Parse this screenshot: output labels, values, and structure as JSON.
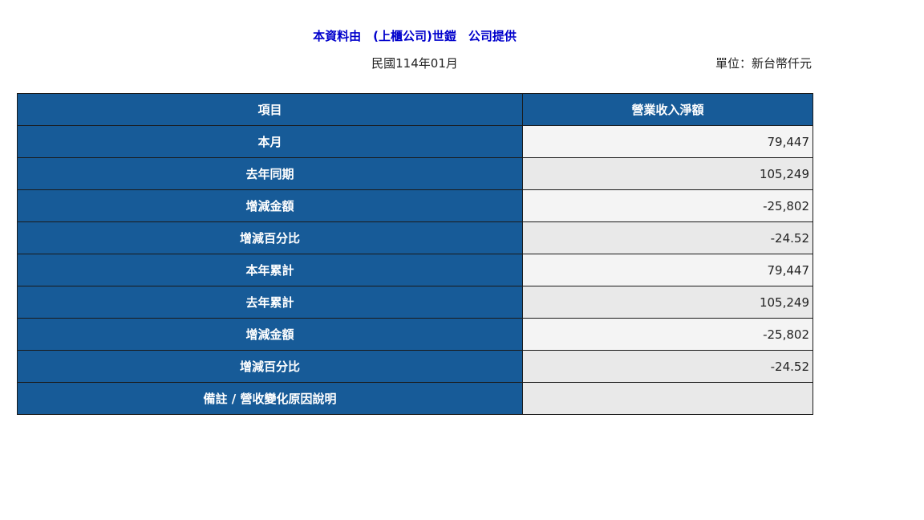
{
  "header": {
    "title": "本資料由　(上櫃公司)世鎧　公司提供",
    "period": "民國114年01月",
    "unit": "單位：新台幣仟元"
  },
  "table": {
    "col_item": "項目",
    "col_revenue": "營業收入淨額",
    "rows": [
      {
        "label": "本月",
        "value": "79,447"
      },
      {
        "label": "去年同期",
        "value": "105,249"
      },
      {
        "label": "增減金額",
        "value": "-25,802"
      },
      {
        "label": "增減百分比",
        "value": "-24.52"
      },
      {
        "label": "本年累計",
        "value": "79,447"
      },
      {
        "label": "去年累計",
        "value": "105,249"
      },
      {
        "label": "增減金額",
        "value": "-25,802"
      },
      {
        "label": "增減百分比",
        "value": "-24.52"
      },
      {
        "label": "備註 / 營收變化原因說明",
        "value": ""
      }
    ]
  }
}
